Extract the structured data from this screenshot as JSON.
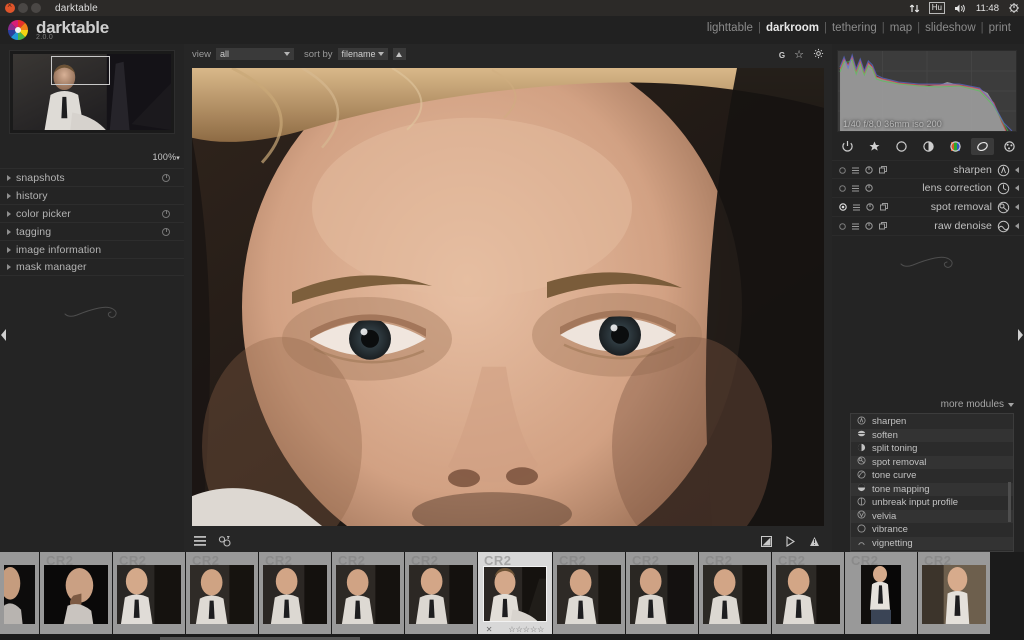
{
  "window": {
    "title": "darktable",
    "controls": [
      "close",
      "minimize",
      "maximize"
    ]
  },
  "tray": {
    "network_icon": "network-updown-icon",
    "keyboard_layout": "Hu",
    "volume_icon": "volume-icon",
    "clock": "11:48",
    "power_icon": "gear-power-icon"
  },
  "header": {
    "app_name": "darktable",
    "version": "2.0.0",
    "logo_icon": "darktable-aperture-logo",
    "views": [
      {
        "label": "lighttable",
        "active": false
      },
      {
        "label": "darkroom",
        "active": true
      },
      {
        "label": "tethering",
        "active": false
      },
      {
        "label": "map",
        "active": false
      },
      {
        "label": "slideshow",
        "active": false
      },
      {
        "label": "print",
        "active": false
      }
    ],
    "separator": "|"
  },
  "left_panel": {
    "navigation": {
      "zoom_level": "100%",
      "zoom_dropdown_icon": "chevron-down-icon",
      "zoom_rect_name": "navigation-zoom-rectangle"
    },
    "sections": [
      {
        "label": "snapshots",
        "has_reset": true
      },
      {
        "label": "history",
        "has_reset": false
      },
      {
        "label": "color picker",
        "has_reset": true
      },
      {
        "label": "tagging",
        "has_reset": true
      },
      {
        "label": "image information",
        "has_reset": false
      },
      {
        "label": "mask manager",
        "has_reset": false
      }
    ],
    "collapse_icon": "collapse-left-arrow-icon",
    "ornament": "flourish-ornament"
  },
  "center": {
    "toolbar": {
      "view_label": "view",
      "view_value": "all",
      "sort_label": "sort by",
      "sort_value": "filename",
      "sort_direction_icon": "sort-ascending-icon",
      "icons": [
        {
          "name": "grouping-icon",
          "glyph": "G"
        },
        {
          "name": "star-overlays-icon",
          "glyph": "☆"
        },
        {
          "name": "preferences-gear-icon",
          "glyph": "⚙"
        }
      ]
    },
    "image_name": "portrait-closeup-photo",
    "bottom_left_icons": [
      {
        "name": "module-list-icon"
      },
      {
        "name": "color-label-icon"
      }
    ],
    "bottom_right_icons": [
      {
        "name": "gamut-check-icon"
      },
      {
        "name": "softproof-icon"
      },
      {
        "name": "overexposed-warning-icon"
      }
    ]
  },
  "right_panel": {
    "histogram": {
      "name": "histogram",
      "exif": "1/40 f/8,0 36mm iso 200"
    },
    "module_groups": [
      {
        "name": "active-modules-group-icon",
        "selected": false
      },
      {
        "name": "favorites-group-icon",
        "selected": false
      },
      {
        "name": "basic-group-icon",
        "selected": false
      },
      {
        "name": "tone-group-icon",
        "selected": false
      },
      {
        "name": "color-group-icon",
        "selected": false
      },
      {
        "name": "correction-group-icon",
        "selected": true
      },
      {
        "name": "effects-group-icon",
        "selected": false
      }
    ],
    "modules": [
      {
        "label": "sharpen",
        "enabled": false,
        "icon": "sharpen-icon",
        "has_multi": true
      },
      {
        "label": "lens correction",
        "enabled": false,
        "icon": "lens-correction-icon",
        "has_multi": false
      },
      {
        "label": "spot removal",
        "enabled": true,
        "icon": "spot-removal-icon",
        "has_multi": true
      },
      {
        "label": "raw denoise",
        "enabled": false,
        "icon": "raw-denoise-icon",
        "has_multi": true
      }
    ],
    "more_modules": {
      "label": "more modules",
      "toggle_icon": "chevron-down-icon",
      "items": [
        {
          "label": "sharpen",
          "icon": "sharpen-icon"
        },
        {
          "label": "soften",
          "icon": "soften-icon"
        },
        {
          "label": "split toning",
          "icon": "split-toning-icon"
        },
        {
          "label": "spot removal",
          "icon": "spot-removal-icon"
        },
        {
          "label": "tone curve",
          "icon": "tone-curve-icon"
        },
        {
          "label": "tone mapping",
          "icon": "tone-mapping-icon"
        },
        {
          "label": "unbreak input profile",
          "icon": "unbreak-input-profile-icon"
        },
        {
          "label": "velvia",
          "icon": "velvia-icon"
        },
        {
          "label": "vibrance",
          "icon": "vibrance-icon"
        },
        {
          "label": "vignetting",
          "icon": "vignetting-icon"
        }
      ]
    },
    "collapse_icon": "collapse-right-arrow-icon",
    "ornament": "flourish-ornament"
  },
  "filmstrip": {
    "file_label": "CR2",
    "selected_index": 7,
    "rating_stars": "☆☆☆☆☆",
    "reject_icon": "✕",
    "thumbnails": [
      {
        "name": "thumb-1"
      },
      {
        "name": "thumb-2"
      },
      {
        "name": "thumb-3"
      },
      {
        "name": "thumb-4"
      },
      {
        "name": "thumb-5"
      },
      {
        "name": "thumb-6"
      },
      {
        "name": "thumb-7"
      },
      {
        "name": "thumb-8"
      },
      {
        "name": "thumb-9"
      },
      {
        "name": "thumb-10"
      },
      {
        "name": "thumb-11"
      },
      {
        "name": "thumb-12"
      },
      {
        "name": "thumb-13"
      },
      {
        "name": "thumb-14"
      }
    ]
  },
  "colors": {
    "panel_bg": "#242424",
    "center_bg": "#262626",
    "header_bg": "#212121",
    "filmstrip_bg": "#1b1b1b",
    "text": "#c2c2c2",
    "active_text": "#e8e8e8",
    "titlebar_close": "#e0552b"
  }
}
